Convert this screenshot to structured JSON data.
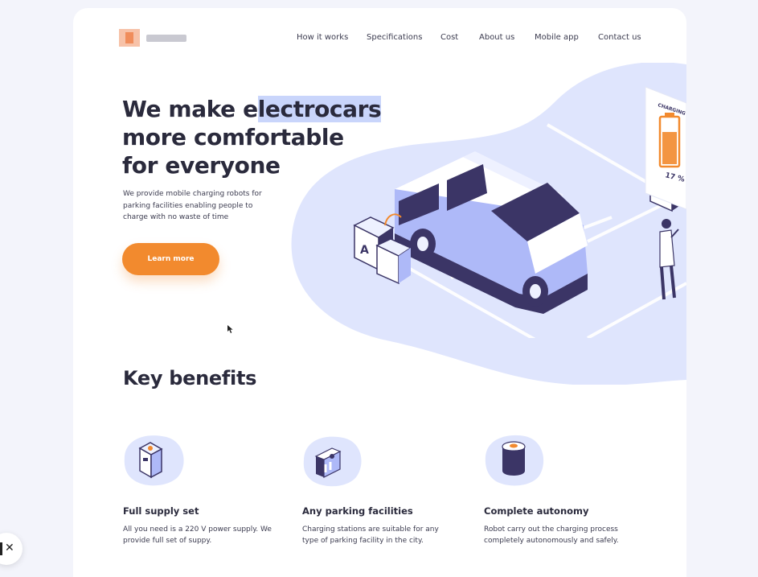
{
  "nav": {
    "items": [
      "How it works",
      "Specifications",
      "Cost",
      "About us",
      "Mobile app",
      "Contact us"
    ]
  },
  "hero": {
    "title_part1": "We make e",
    "title_highlight": "lectrocars",
    "title_line2": "more comfortable",
    "title_line3": "for everyone",
    "subtitle": "We provide mobile charging robots for parking facilities enabling people to charge with no waste of time",
    "cta_label": "Learn more"
  },
  "illustration": {
    "charging_label": "CHARGING",
    "battery_percent": "17 %",
    "battery_level": 0.17,
    "robot_letter": "A"
  },
  "benefits": {
    "title": "Key benefits",
    "items": [
      {
        "title": "Full supply set",
        "desc": "All you need is a 220 V power supply. We provide full set of suppy."
      },
      {
        "title": "Any parking facilities",
        "desc": "Charging stations are suitable for any type of parking facility in the city."
      },
      {
        "title": "Complete autonomy",
        "desc": "Robot carry out the charging process completely autonomously and safely."
      }
    ]
  },
  "colors": {
    "accent": "#f28a2e",
    "blob": "#dfe5fd",
    "navy": "#3b3566",
    "highlight": "#c9d5fb"
  }
}
